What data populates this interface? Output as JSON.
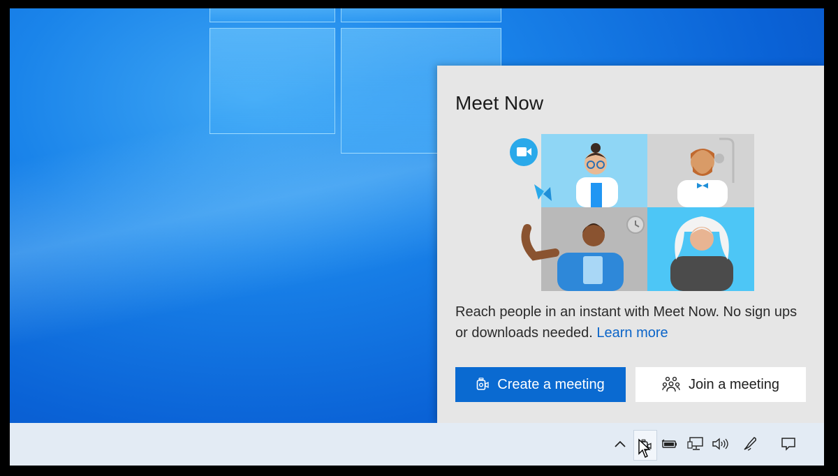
{
  "flyout": {
    "title": "Meet Now",
    "description": "Reach people in an instant with Meet Now. No sign ups or downloads needed.",
    "learn_more": "Learn more",
    "create_button": "Create a meeting",
    "join_button": "Join a meeting"
  },
  "taskbar": {
    "icons": [
      "chevron-up-icon",
      "meet-now-icon",
      "battery-icon",
      "network-icon",
      "volume-icon",
      "pen-icon",
      "notifications-icon"
    ]
  },
  "colors": {
    "accent": "#0a6ad1",
    "flyout_bg": "#e6e6e6",
    "taskbar_bg": "#e3ebf4",
    "link": "#0a64c8"
  }
}
